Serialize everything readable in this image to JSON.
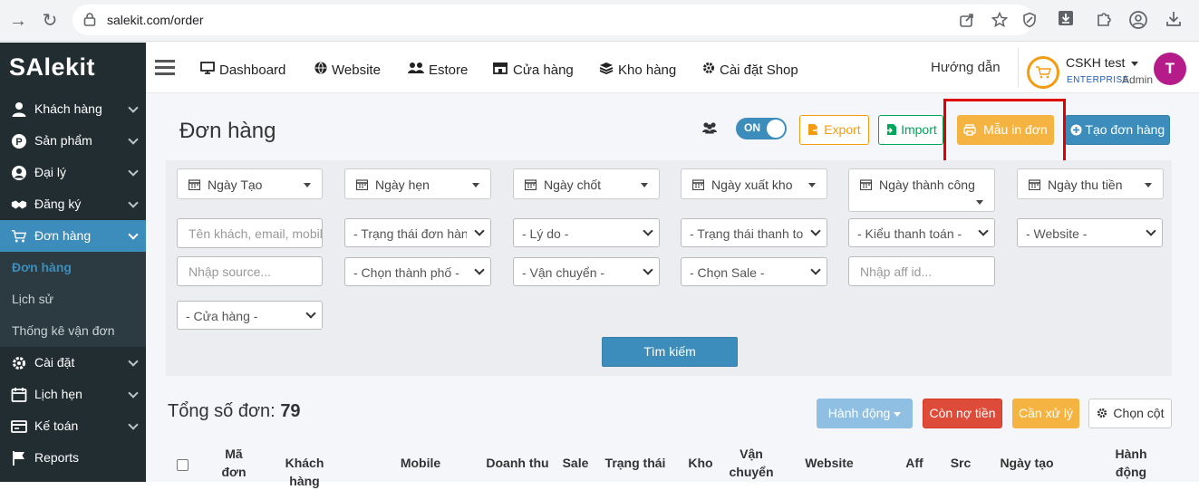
{
  "browser": {
    "url": "salekit.com/order"
  },
  "app": {
    "logo": "SAlekit"
  },
  "sidebar": {
    "items": [
      {
        "label": "Khách hàng",
        "icon": "user-icon"
      },
      {
        "label": "Sản phẩm",
        "icon": "product-icon"
      },
      {
        "label": "Đại lý",
        "icon": "agent-icon"
      },
      {
        "label": "Đăng ký",
        "icon": "handshake-icon"
      },
      {
        "label": "Đơn hàng",
        "icon": "cart-icon"
      },
      {
        "label": "Cài đặt",
        "icon": "gear-icon"
      },
      {
        "label": "Lịch hẹn",
        "icon": "calendar-icon"
      },
      {
        "label": "Kế toán",
        "icon": "accounting-icon"
      },
      {
        "label": "Reports",
        "icon": "flag-icon"
      }
    ],
    "subitems": [
      {
        "label": "Đơn hàng"
      },
      {
        "label": "Lịch sử"
      },
      {
        "label": "Thống kê vận đơn"
      }
    ]
  },
  "topnav": {
    "links": [
      {
        "label": "Dashboard",
        "icon": "monitor-icon"
      },
      {
        "label": "Website",
        "icon": "globe-icon"
      },
      {
        "label": "Estore",
        "icon": "users-icon"
      },
      {
        "label": "Cửa hàng",
        "icon": "store-icon"
      },
      {
        "label": "Kho hàng",
        "icon": "layers-icon"
      },
      {
        "label": "Cài đặt Shop",
        "icon": "gear-icon"
      }
    ],
    "guide": "Hướng dẫn",
    "user": {
      "name": "CSKH test",
      "tier": "ENTERPRISE",
      "role": "Admin",
      "initial": "T"
    }
  },
  "page": {
    "title": "Đơn hàng",
    "toggle_label": "ON",
    "buttons": {
      "export": "Export",
      "import": "Import",
      "print_template": "Mẫu in đơn",
      "create_order": "Tạo đơn hàng"
    }
  },
  "filters": {
    "date_filters": [
      "Ngày Tạo",
      "Ngày hẹn",
      "Ngày chốt",
      "Ngày xuất kho",
      "Ngày thành công",
      "Ngày thu tiền"
    ],
    "search_placeholder": "Tên khách, email, mobile",
    "selects_row1": [
      "- Trạng thái đơn hàng -",
      "- Lý do -",
      "- Trạng thái thanh toán -",
      "- Kiểu thanh toán -",
      "- Website -"
    ],
    "source_placeholder": "Nhập source...",
    "selects_row2": [
      "- Chọn thành phố -",
      "- Vận chuyển -",
      "- Chọn Sale -"
    ],
    "aff_placeholder": "Nhập aff id...",
    "store_select": "- Cửa hàng -",
    "search_button": "Tìm kiếm"
  },
  "summary": {
    "total_label": "Tổng số đơn:",
    "total_value": "79",
    "action_button": "Hành động",
    "debt_button": "Còn nợ tiền",
    "handle_button": "Cần xử lý",
    "columns_button": "Chọn cột"
  },
  "table": {
    "columns": [
      "Mã đơn",
      "Khách hàng",
      "Mobile",
      "Doanh thu",
      "Sale",
      "Trạng thái",
      "Kho",
      "Vận chuyển",
      "Website",
      "Aff",
      "Src",
      "Ngày tạo",
      "Hành động"
    ]
  },
  "colors": {
    "sidebar_bg": "#222d32",
    "primary": "#3c8dbc",
    "warning": "#f5b442",
    "danger": "#dd4b39",
    "success": "#00a65a",
    "highlight": "#e00000"
  }
}
